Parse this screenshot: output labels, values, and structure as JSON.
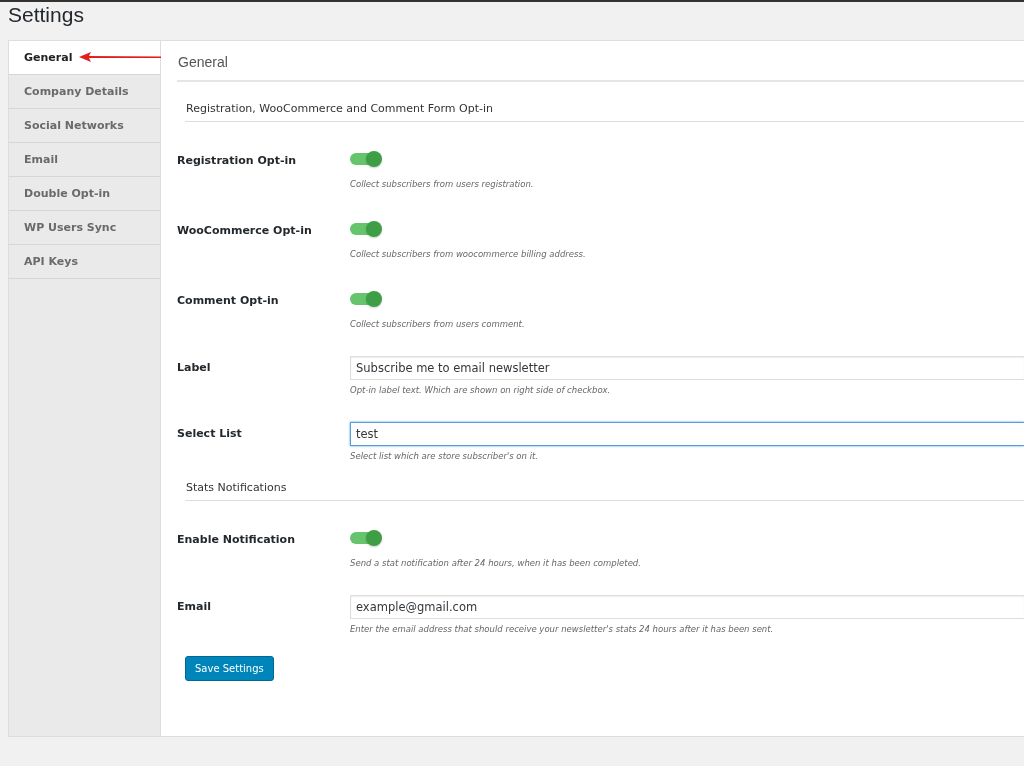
{
  "page_title": "Settings",
  "tabs": [
    {
      "label": "General",
      "selected": true
    },
    {
      "label": "Company Details",
      "selected": false
    },
    {
      "label": "Social Networks",
      "selected": false
    },
    {
      "label": "Email",
      "selected": false
    },
    {
      "label": "Double Opt-in",
      "selected": false
    },
    {
      "label": "WP Users Sync",
      "selected": false
    },
    {
      "label": "API Keys",
      "selected": false
    }
  ],
  "panel_title": "General",
  "sections": [
    {
      "heading": "Registration, WooCommerce and Comment Form Opt-in",
      "fields": [
        {
          "kind": "toggle",
          "label": "Registration Opt-in",
          "on": true,
          "description": "Collect subscribers from users registration."
        },
        {
          "kind": "toggle",
          "label": "WooCommerce Opt-in",
          "on": true,
          "description": "Collect subscribers from woocommerce billing address."
        },
        {
          "kind": "toggle",
          "label": "Comment Opt-in",
          "on": true,
          "description": "Collect subscribers from users comment."
        },
        {
          "kind": "input",
          "label": "Label",
          "value": "Subscribe me to email newsletter",
          "focused": false,
          "description": "Opt-in label text. Which are shown on right side of checkbox."
        },
        {
          "kind": "input",
          "label": "Select List",
          "value": "test",
          "focused": true,
          "description": "Select list which are store subscriber's on it."
        }
      ]
    },
    {
      "heading": "Stats Notifications",
      "fields": [
        {
          "kind": "toggle",
          "label": "Enable Notification",
          "on": true,
          "description": "Send a stat notification after 24 hours, when it has been completed."
        },
        {
          "kind": "input",
          "label": "Email",
          "value": "example@gmail.com",
          "focused": false,
          "description": "Enter the email address that should receive your newsletter's stats 24 hours after it has been sent."
        }
      ]
    }
  ],
  "save_button": "Save Settings"
}
